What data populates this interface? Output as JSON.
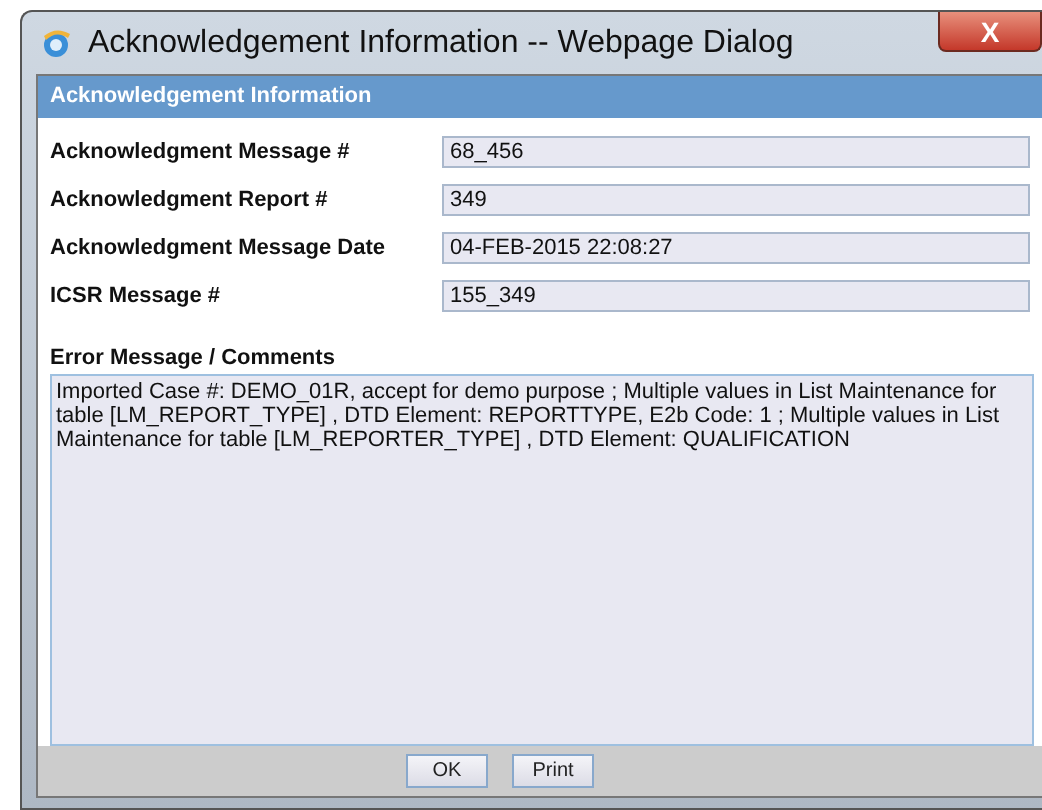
{
  "window": {
    "title": "Acknowledgement Information -- Webpage Dialog",
    "close": "X"
  },
  "section": {
    "title": "Acknowledgement Information"
  },
  "fields": [
    {
      "label": "Acknowledgment Message #",
      "value": "68_456"
    },
    {
      "label": "Acknowledgment Report #",
      "value": "349"
    },
    {
      "label": "Acknowledgment Message Date",
      "value": "04-FEB-2015 22:08:27"
    },
    {
      "label": "ICSR Message #",
      "value": "155_349"
    }
  ],
  "comments": {
    "label": "Error Message / Comments",
    "value": "Imported Case #: DEMO_01R, accept for demo purpose ; Multiple values in List Maintenance for table [LM_REPORT_TYPE] , DTD Element: REPORTTYPE, E2b Code: 1 ; Multiple values in List Maintenance for table [LM_REPORTER_TYPE] , DTD Element: QUALIFICATION"
  },
  "buttons": [
    "OK",
    "Print"
  ]
}
